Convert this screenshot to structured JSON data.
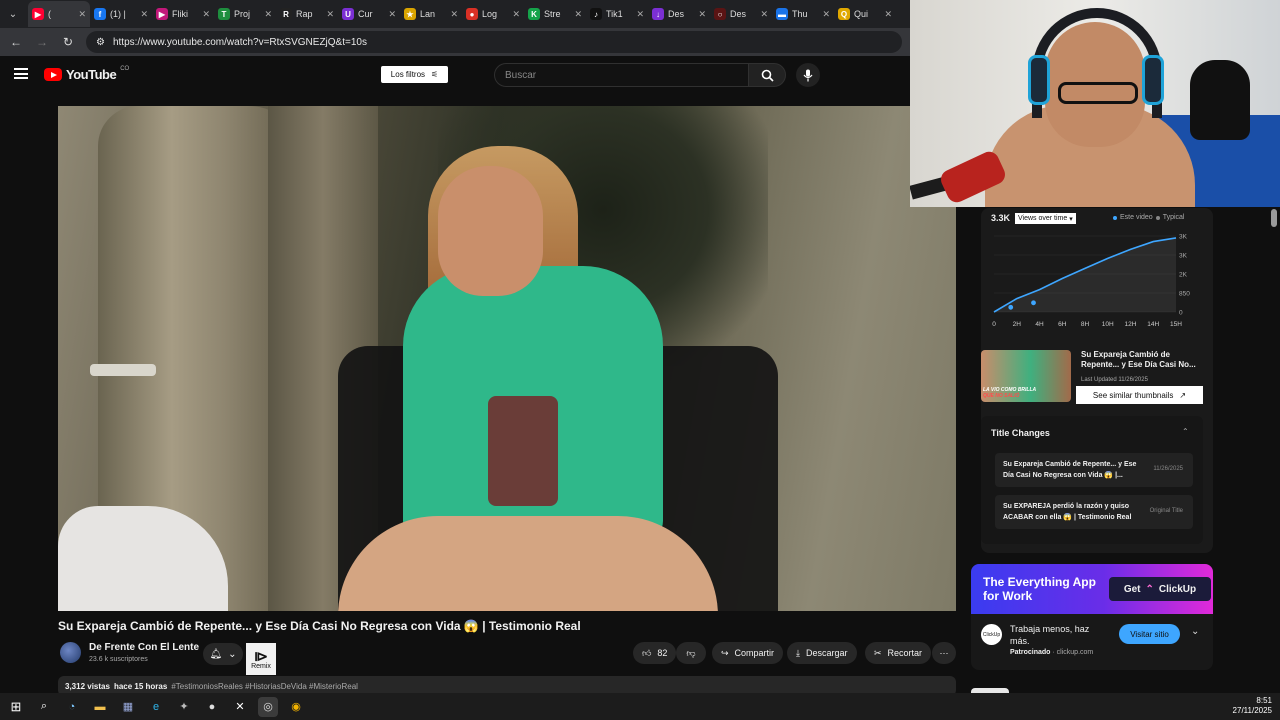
{
  "browser": {
    "tabs": [
      {
        "label": "(",
        "color": "#ff0033",
        "glyph": "▶"
      },
      {
        "label": "(1) |",
        "color": "#1877f2",
        "glyph": "f"
      },
      {
        "label": "Fliki",
        "color": "#c2187a",
        "glyph": "▶"
      },
      {
        "label": "Proj",
        "color": "#1e8e3e",
        "glyph": "T"
      },
      {
        "label": "Rap",
        "color": "#222222",
        "glyph": "R"
      },
      {
        "label": "Cur",
        "color": "#7b2fd4",
        "glyph": "U"
      },
      {
        "label": "Lan",
        "color": "#d9a400",
        "glyph": "★"
      },
      {
        "label": "Log",
        "color": "#d93025",
        "glyph": "●"
      },
      {
        "label": "Stre",
        "color": "#15a34a",
        "glyph": "K"
      },
      {
        "label": "Tik1",
        "color": "#111111",
        "glyph": "♪"
      },
      {
        "label": "Des",
        "color": "#7b2fd4",
        "glyph": "↓"
      },
      {
        "label": "Des",
        "color": "#5a1414",
        "glyph": "○"
      },
      {
        "label": "Thu",
        "color": "#1a73e8",
        "glyph": "▬"
      },
      {
        "label": "Qui",
        "color": "#e0a800",
        "glyph": "Q"
      }
    ],
    "url": "https://www.youtube.com/watch?v=RtxSVGNEZjQ&t=10s"
  },
  "youtube": {
    "logo_text": "YouTube",
    "country_code": "CO",
    "filters_label": "Los filtros",
    "search_placeholder": "Buscar"
  },
  "video": {
    "title": "Su Expareja Cambió de Repente... y Ese Día Casi No Regresa con Vida 😱 | Testimonio Real",
    "channel": "De Frente Con El Lente",
    "subscribers": "23.6 k suscriptores",
    "remix_label": "Remix",
    "likes": "82",
    "share_label": "Compartir",
    "download_label": "Descargar",
    "clip_label": "Recortar",
    "views": "3,312 vistas",
    "time_ago": "hace 15 horas",
    "hashtags": "#TestimoniosReales #HistoriasDeVida #MisterioReal"
  },
  "stats": {
    "views_total": "3.3K",
    "selector_label": "Views over time",
    "legend": [
      {
        "name": "Este video",
        "color": "#3ea6ff"
      },
      {
        "name": "Typical",
        "color": "#888888"
      }
    ]
  },
  "chart_data": {
    "type": "line",
    "x": [
      "0",
      "2H",
      "4H",
      "6H",
      "8H",
      "10H",
      "12H",
      "14H",
      "15H"
    ],
    "y_ticks": [
      "3K",
      "3K",
      "2K",
      "850",
      "0"
    ],
    "ylim": [
      0,
      3400
    ],
    "series": [
      {
        "name": "Este video",
        "values": [
          0,
          600,
          1000,
          1500,
          1950,
          2400,
          2800,
          3150,
          3312
        ]
      }
    ]
  },
  "similar": {
    "title": "Su Expareja Cambió de Repente... y Ese Día Casi No...",
    "date": "Last Updated 11/26/2025",
    "button_label": "See similar thumbnails",
    "thumb_text_1": "LA VIO COMO BRILLA",
    "thumb_text_2": "QUE NO SALIÓ"
  },
  "title_changes": {
    "heading": "Title Changes",
    "rows": [
      {
        "title": "Su Expareja Cambió de Repente... y Ese Día Casi No Regresa con Vida 😱 |...",
        "tag": "11/26/2025"
      },
      {
        "title": "Su EXPAREJA perdió la razón y quiso ACABAR con ella 😱 | Testimonio Real",
        "tag": "Original Title"
      }
    ]
  },
  "ad": {
    "headline": "The Everything App for Work",
    "get_label": "Get",
    "brand": "ClickUp",
    "text": "Trabaja menos, haz más.",
    "sponsored": "Patrocinado",
    "domain": "· clickup.com",
    "cta": "Visitar sitio"
  },
  "taskbar": {
    "time": "8:51",
    "date": "27/11/2025"
  }
}
